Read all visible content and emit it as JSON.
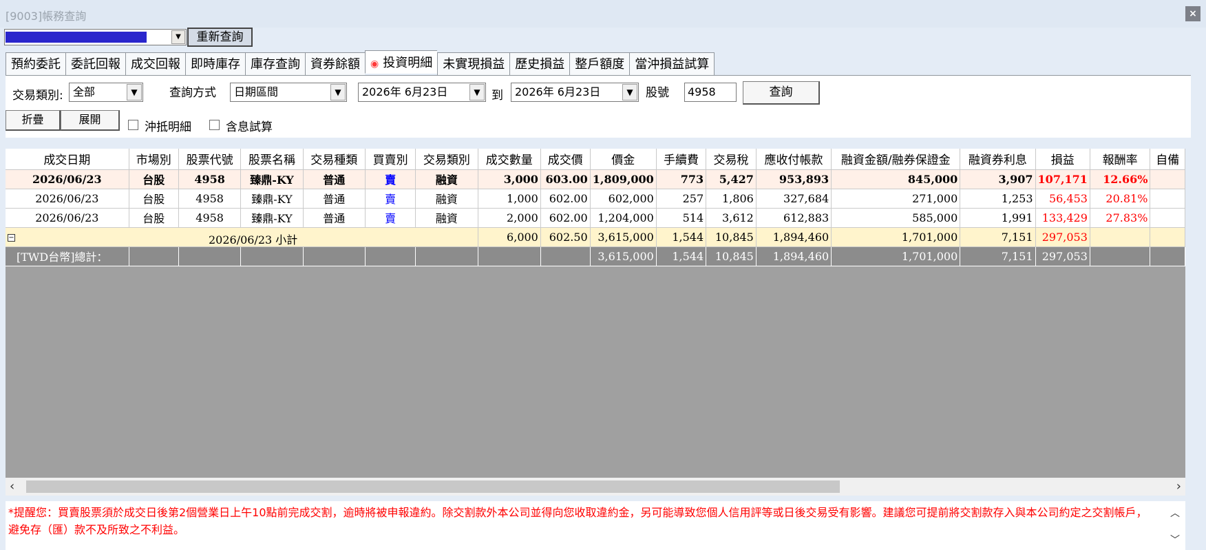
{
  "window": {
    "title": "[9003]帳務查詢",
    "close": "×"
  },
  "account": {
    "requery_label": "重新查詢"
  },
  "tabs": [
    "預約委託",
    "委託回報",
    "成交回報",
    "即時庫存",
    "庫存查詢",
    "資券餘額",
    "投資明細",
    "未實現損益",
    "歷史損益",
    "整戶額度",
    "當沖損益試算"
  ],
  "active_tab": "投資明細",
  "filters": {
    "trade_type_label": "交易類別:",
    "trade_type_value": "全部",
    "method_label": "查詢方式",
    "method_value": "日期區間",
    "date_from": "2026年 6月23日",
    "to_label": "到",
    "date_to": "2026年 6月23日",
    "stock_label": "股號",
    "stock_value": "4958",
    "query_label": "查詢",
    "collapse_label": "折疊",
    "expand_label": "展開",
    "offset_detail_label": "沖抵明細",
    "include_interest_label": "含息試算"
  },
  "table": {
    "headers": [
      "成交日期",
      "市場別",
      "股票代號",
      "股票名稱",
      "交易種類",
      "買賣別",
      "交易類別",
      "成交數量",
      "成交價",
      "價金",
      "手續費",
      "交易稅",
      "應收付帳款",
      "融資金額/融券保證金",
      "融資券利息",
      "損益",
      "報酬率",
      "自備"
    ],
    "rows": [
      {
        "date": "2026/06/23",
        "market": "台股",
        "code": "4958",
        "name": "臻鼎-KY",
        "kind": "普通",
        "side": "賣",
        "type": "融資",
        "qty": "3,000",
        "price": "603.00",
        "amount": "1,809,000",
        "fee": "773",
        "tax": "5,427",
        "receivable": "953,893",
        "margin": "845,000",
        "interest": "3,907",
        "pnl": "107,171",
        "roi": "12.66%",
        "own": ""
      },
      {
        "date": "2026/06/23",
        "market": "台股",
        "code": "4958",
        "name": "臻鼎-KY",
        "kind": "普通",
        "side": "賣",
        "type": "融資",
        "qty": "1,000",
        "price": "602.00",
        "amount": "602,000",
        "fee": "257",
        "tax": "1,806",
        "receivable": "327,684",
        "margin": "271,000",
        "interest": "1,253",
        "pnl": "56,453",
        "roi": "20.81%",
        "own": ""
      },
      {
        "date": "2026/06/23",
        "market": "台股",
        "code": "4958",
        "name": "臻鼎-KY",
        "kind": "普通",
        "side": "賣",
        "type": "融資",
        "qty": "2,000",
        "price": "602.00",
        "amount": "1,204,000",
        "fee": "514",
        "tax": "3,612",
        "receivable": "612,883",
        "margin": "585,000",
        "interest": "1,991",
        "pnl": "133,429",
        "roi": "27.83%",
        "own": ""
      }
    ],
    "subtotal": {
      "toggle": "−",
      "label": "2026/06/23 小計",
      "qty": "6,000",
      "price": "602.50",
      "amount": "3,615,000",
      "fee": "1,544",
      "tax": "10,845",
      "receivable": "1,894,460",
      "margin": "1,701,000",
      "interest": "7,151",
      "pnl": "297,053"
    },
    "total": {
      "label": "[TWD台幣]總計：",
      "amount": "3,615,000",
      "fee": "1,544",
      "tax": "10,845",
      "receivable": "1,894,460",
      "margin": "1,701,000",
      "interest": "7,151",
      "pnl": "297,053"
    }
  },
  "notice": "*提醒您：買賣股票須於成交日後第2個營業日上午10點前完成交割，逾時將被申報違約。除交割款外本公司並得向您收取違約金，另可能導致您個人信用評等或日後交易受有影響。建議您可提前將交割款存入與本公司約定之交割帳戶，避免存（匯）款不及所致之不利益。",
  "colors": {
    "accent_red": "#ff0000",
    "sell_blue": "#0000ff",
    "account_fill": "#2a26cc"
  }
}
